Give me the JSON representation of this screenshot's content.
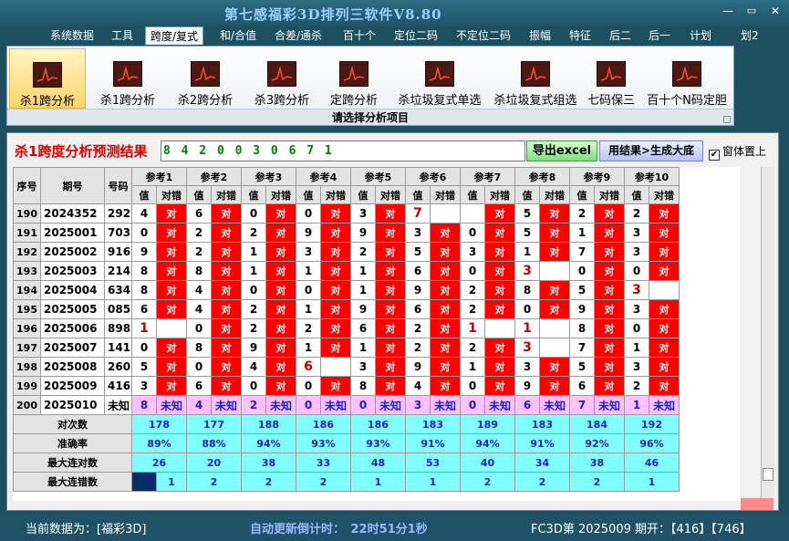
{
  "window": {
    "title": "第七感福彩3D排列三软件V8.80",
    "btn_min": "—",
    "btn_max": "▭",
    "btn_close": "✕"
  },
  "menu": [
    {
      "label": "系统数据",
      "selected": false
    },
    {
      "label": "工具",
      "selected": false
    },
    {
      "label": "跨度/复式",
      "selected": true
    },
    {
      "label": "和/合值",
      "selected": false
    },
    {
      "label": "合差/通杀",
      "selected": false
    },
    {
      "label": "百十个",
      "selected": false
    },
    {
      "label": "定位二码",
      "selected": false
    },
    {
      "label": "不定位二码",
      "selected": false
    },
    {
      "label": "振幅",
      "selected": false
    },
    {
      "label": "特征",
      "selected": false
    },
    {
      "label": "后二",
      "selected": false
    },
    {
      "label": "后一",
      "selected": false
    },
    {
      "label": "计划",
      "selected": false
    },
    {
      "label": "划2",
      "selected": false
    }
  ],
  "ribbon": {
    "buttons": [
      {
        "label": "杀1跨分析",
        "selected": true
      },
      {
        "label": "杀1跨分析",
        "selected": false
      },
      {
        "label": "杀2跨分析",
        "selected": false
      },
      {
        "label": "杀3跨分析",
        "selected": false
      },
      {
        "label": "定跨分析",
        "selected": false
      },
      {
        "label": "杀垃圾复式单选",
        "selected": false
      },
      {
        "label": "杀垃圾复式组选",
        "selected": false
      },
      {
        "label": "七码保三",
        "selected": false
      },
      {
        "label": "百十个N码定胆",
        "selected": false
      }
    ],
    "caption": "请选择分析项目"
  },
  "panel": {
    "result_label": "杀1跨度分析预测结果",
    "result_value": "8 4 2 0 0 3 0 6 7 1",
    "btn_excel": "导出excel",
    "btn_generate": "用结果>生成大底",
    "checkbox": {
      "label": "窗体置上",
      "checked": true,
      "mark": "✔"
    }
  },
  "table": {
    "headers": {
      "seq": "序号",
      "issue": "期号",
      "number": "号码",
      "value": "值",
      "hit": "对错",
      "refs": [
        "参考1",
        "参考2",
        "参考3",
        "参考4",
        "参考5",
        "参考6",
        "参考7",
        "参考8",
        "参考9",
        "参考10"
      ]
    },
    "right_mark": "对",
    "unknown_label": "未知",
    "rows": [
      {
        "seq": "190",
        "issue": "2024352",
        "number": "292",
        "vals": [
          "4",
          "6",
          "0",
          "0",
          "3",
          "7",
          "",
          "5",
          "2",
          "2"
        ],
        "hits": [
          1,
          1,
          1,
          1,
          1,
          0,
          1,
          1,
          1,
          1
        ],
        "miss": [
          0,
          0,
          0,
          0,
          0,
          1,
          0,
          0,
          0,
          0
        ]
      },
      {
        "seq": "191",
        "issue": "2025001",
        "number": "703",
        "vals": [
          "0",
          "2",
          "2",
          "9",
          "9",
          "3",
          "0",
          "5",
          "1",
          "3"
        ],
        "hits": [
          1,
          1,
          1,
          1,
          1,
          1,
          1,
          1,
          1,
          1
        ],
        "miss": [
          0,
          0,
          0,
          0,
          0,
          0,
          0,
          0,
          0,
          0
        ]
      },
      {
        "seq": "192",
        "issue": "2025002",
        "number": "916",
        "vals": [
          "9",
          "2",
          "1",
          "3",
          "2",
          "5",
          "3",
          "1",
          "7",
          "3"
        ],
        "hits": [
          1,
          1,
          1,
          1,
          1,
          1,
          1,
          1,
          1,
          1
        ],
        "miss": [
          0,
          0,
          0,
          0,
          0,
          0,
          0,
          0,
          0,
          0
        ]
      },
      {
        "seq": "193",
        "issue": "2025003",
        "number": "214",
        "vals": [
          "8",
          "8",
          "1",
          "1",
          "1",
          "6",
          "0",
          "3",
          "0",
          "0"
        ],
        "hits": [
          1,
          1,
          1,
          1,
          1,
          1,
          1,
          0,
          1,
          1
        ],
        "miss": [
          0,
          0,
          0,
          0,
          0,
          0,
          0,
          1,
          0,
          0
        ]
      },
      {
        "seq": "194",
        "issue": "2025004",
        "number": "634",
        "vals": [
          "8",
          "4",
          "0",
          "0",
          "1",
          "9",
          "2",
          "8",
          "5",
          "3"
        ],
        "hits": [
          1,
          1,
          1,
          1,
          1,
          1,
          1,
          1,
          1,
          0
        ],
        "miss": [
          0,
          0,
          0,
          0,
          0,
          0,
          0,
          0,
          0,
          1
        ]
      },
      {
        "seq": "195",
        "issue": "2025005",
        "number": "085",
        "vals": [
          "6",
          "4",
          "2",
          "1",
          "9",
          "6",
          "2",
          "0",
          "9",
          "3"
        ],
        "hits": [
          1,
          1,
          1,
          1,
          1,
          1,
          1,
          1,
          1,
          1
        ],
        "miss": [
          0,
          0,
          0,
          0,
          0,
          0,
          0,
          0,
          0,
          0
        ]
      },
      {
        "seq": "196",
        "issue": "2025006",
        "number": "898",
        "vals": [
          "1",
          "0",
          "2",
          "2",
          "6",
          "2",
          "1",
          "1",
          "8",
          "0"
        ],
        "hits": [
          0,
          1,
          1,
          1,
          1,
          1,
          0,
          0,
          1,
          1
        ],
        "miss": [
          1,
          0,
          0,
          0,
          0,
          0,
          1,
          1,
          0,
          0
        ]
      },
      {
        "seq": "197",
        "issue": "2025007",
        "number": "141",
        "vals": [
          "0",
          "8",
          "9",
          "1",
          "1",
          "2",
          "2",
          "3",
          "7",
          "1"
        ],
        "hits": [
          1,
          1,
          1,
          1,
          1,
          1,
          1,
          0,
          1,
          1
        ],
        "miss": [
          0,
          0,
          0,
          0,
          0,
          0,
          0,
          1,
          0,
          0
        ]
      },
      {
        "seq": "198",
        "issue": "2025008",
        "number": "260",
        "vals": [
          "5",
          "0",
          "4",
          "6",
          "3",
          "9",
          "1",
          "3",
          "5",
          "3"
        ],
        "hits": [
          1,
          1,
          1,
          0,
          1,
          1,
          1,
          1,
          1,
          1
        ],
        "miss": [
          0,
          0,
          0,
          1,
          0,
          0,
          0,
          0,
          0,
          0
        ]
      },
      {
        "seq": "199",
        "issue": "2025009",
        "number": "416",
        "vals": [
          "3",
          "6",
          "0",
          "0",
          "8",
          "4",
          "0",
          "9",
          "6",
          "2"
        ],
        "hits": [
          1,
          1,
          1,
          1,
          1,
          1,
          1,
          1,
          1,
          1
        ],
        "miss": [
          0,
          0,
          0,
          0,
          0,
          0,
          0,
          0,
          0,
          0
        ]
      }
    ],
    "pred_row": {
      "seq": "200",
      "issue": "2025010",
      "number": "未知",
      "vals": [
        "8",
        "4",
        "2",
        "0",
        "0",
        "3",
        "0",
        "6",
        "7",
        "1"
      ]
    },
    "summary": [
      {
        "label": "对次数",
        "vals": [
          "178",
          "177",
          "188",
          "186",
          "186",
          "183",
          "189",
          "183",
          "184",
          "192"
        ]
      },
      {
        "label": "准确率",
        "vals": [
          "89%",
          "88%",
          "94%",
          "93%",
          "93%",
          "91%",
          "94%",
          "91%",
          "92%",
          "96%"
        ]
      },
      {
        "label": "最大连对数",
        "vals": [
          "26",
          "20",
          "38",
          "33",
          "48",
          "53",
          "40",
          "34",
          "38",
          "46"
        ]
      },
      {
        "label": "最大连错数",
        "vals": [
          "1",
          "2",
          "2",
          "2",
          "1",
          "1",
          "2",
          "2",
          "2",
          "1"
        ]
      }
    ]
  },
  "status": {
    "current_data": "当前数据为：[福彩3D]",
    "countdown": "自动更新倒计时：　22时51分1秒",
    "draw": "FC3D第 2025009 期开：【416】【746】"
  },
  "colors": {
    "hit": "#ff0000",
    "pred": "#ffc0ff",
    "summary": "#80ffff",
    "title": "#9ad0ff"
  }
}
